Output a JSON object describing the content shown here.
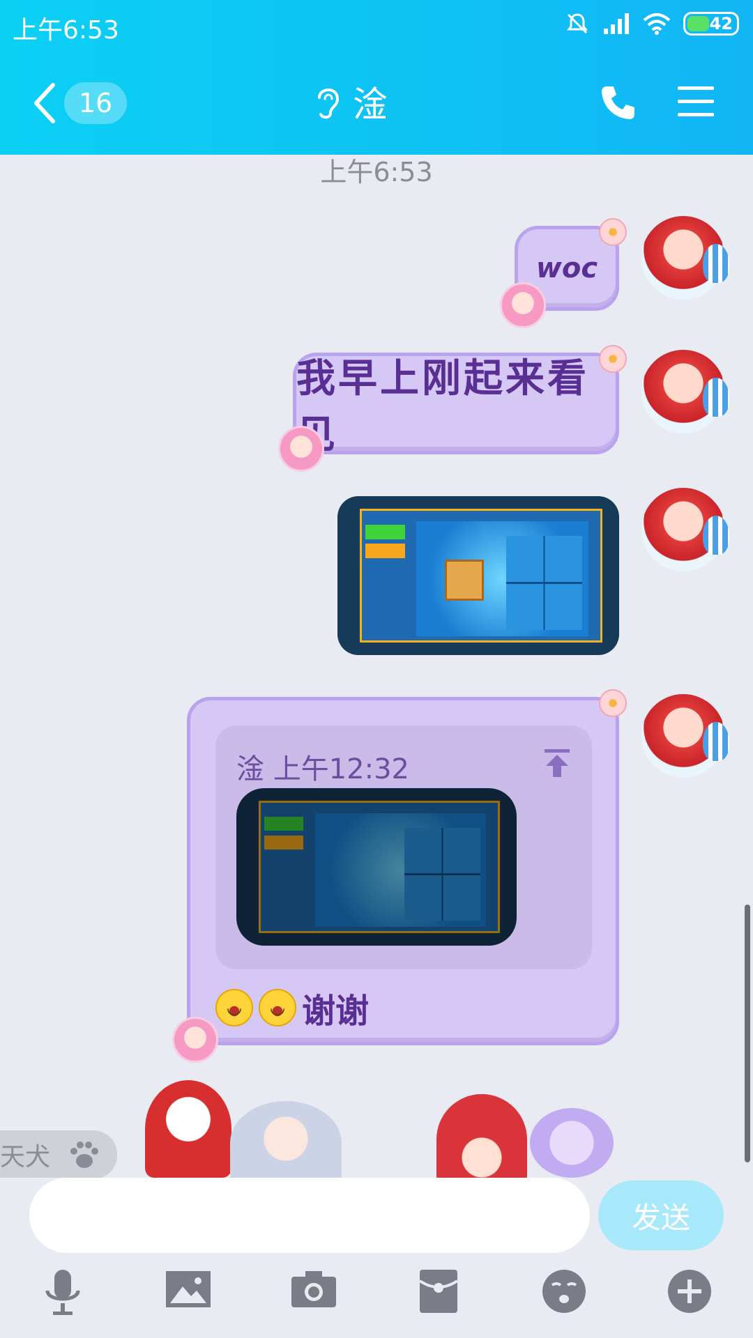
{
  "status_bar": {
    "time": "上午6:53",
    "battery": "42",
    "icons": [
      "mute-bell-icon",
      "signal-icon",
      "wifi-icon",
      "battery-icon"
    ]
  },
  "header": {
    "unread_count": "16",
    "title": "淦",
    "icons": [
      "back-chevron-icon",
      "ear-icon",
      "phone-icon",
      "menu-icon"
    ]
  },
  "chat": {
    "timestamp": "上午6:53",
    "messages": [
      {
        "type": "text",
        "text": "woc"
      },
      {
        "type": "text",
        "text": "我早上刚起来看见"
      },
      {
        "type": "image"
      },
      {
        "type": "reply",
        "quote_header": "淦 上午12:32",
        "text": "谢谢",
        "emoji": "😂😂"
      }
    ]
  },
  "sticker_bar": {
    "chip_label": "天犬",
    "chip_icon": "paw-icon"
  },
  "input": {
    "value": "",
    "placeholder": "",
    "send_label": "发送"
  },
  "toolbar": {
    "icons": [
      "microphone-icon",
      "image-icon",
      "camera-icon",
      "red-packet-icon",
      "emoji-icon",
      "plus-icon"
    ]
  },
  "colors": {
    "header_gradient_start": "#0bd0f4",
    "header_gradient_end": "#12b6f5",
    "bubble_fill": "#d6c8f5",
    "bubble_border": "#b9a2ee",
    "bubble_text": "#5a2f93",
    "send_button": "#a8e8fb",
    "background": "#e9ebf2"
  }
}
